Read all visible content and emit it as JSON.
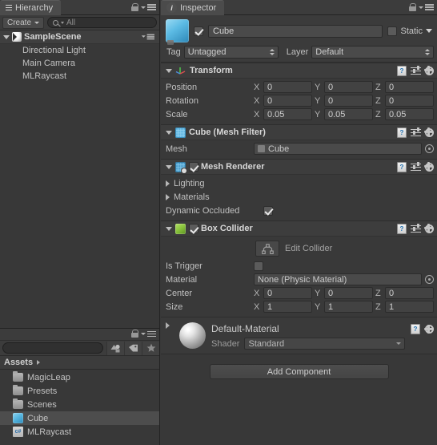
{
  "hierarchy": {
    "tab_label": "Hierarchy",
    "tab_icon": "hierarchy-icon",
    "create_label": "Create",
    "search_placeholder": "All",
    "search_value": "All",
    "scene": {
      "name": "SampleScene",
      "icon": "unity-scene-icon"
    },
    "items": [
      {
        "label": "Directional Light"
      },
      {
        "label": "Main Camera"
      },
      {
        "label": "MLRaycast"
      }
    ]
  },
  "project": {
    "search_value": "",
    "search_placeholder": "",
    "filters": [
      {
        "name": "type-filter-icon"
      },
      {
        "name": "label-filter-icon"
      },
      {
        "name": "favorites-star-icon"
      }
    ],
    "breadcrumb": "Assets",
    "items": [
      {
        "label": "MagicLeap",
        "icon": "folder-icon",
        "selected": false
      },
      {
        "label": "Presets",
        "icon": "folder-icon",
        "selected": false
      },
      {
        "label": "Scenes",
        "icon": "folder-icon",
        "selected": false
      },
      {
        "label": "Cube",
        "icon": "cube-prefab-icon",
        "selected": true
      },
      {
        "label": "MLRaycast",
        "icon": "csharp-script-icon",
        "selected": false
      }
    ]
  },
  "inspector": {
    "tab_label": "Inspector",
    "tab_icon": "info-icon",
    "gameobject": {
      "icon": "cube-prefab-icon",
      "enabled": true,
      "name": "Cube",
      "static_label": "Static",
      "static_checked": false,
      "tag_label": "Tag",
      "tag_value": "Untagged",
      "layer_label": "Layer",
      "layer_value": "Default"
    },
    "components": [
      {
        "title": "Transform",
        "icon": "transform-gizmo-icon",
        "has_enable_checkbox": false,
        "rows": [
          {
            "label": "Position",
            "type": "vector3",
            "x": "0",
            "y": "0",
            "z": "0"
          },
          {
            "label": "Rotation",
            "type": "vector3",
            "x": "0",
            "y": "0",
            "z": "0"
          },
          {
            "label": "Scale",
            "type": "vector3",
            "x": "0.05",
            "y": "0.05",
            "z": "0.05"
          }
        ]
      },
      {
        "title": "Cube (Mesh Filter)",
        "icon": "mesh-filter-icon",
        "has_enable_checkbox": false,
        "rows": [
          {
            "label": "Mesh",
            "type": "object",
            "value": "Cube"
          }
        ]
      },
      {
        "title": "Mesh Renderer",
        "icon": "mesh-renderer-icon",
        "has_enable_checkbox": true,
        "enabled": true,
        "rows": [
          {
            "label": "Lighting",
            "type": "foldout"
          },
          {
            "label": "Materials",
            "type": "foldout"
          },
          {
            "label": "Dynamic Occluded",
            "type": "checkbox",
            "checked": true
          }
        ]
      },
      {
        "title": "Box Collider",
        "icon": "box-collider-icon",
        "has_enable_checkbox": true,
        "enabled": true,
        "edit_collider_label": "Edit Collider",
        "rows": [
          {
            "label": "Is Trigger",
            "type": "checkbox",
            "checked": false
          },
          {
            "label": "Material",
            "type": "object",
            "value": "None (Physic Material)"
          },
          {
            "label": "Center",
            "type": "vector3",
            "x": "0",
            "y": "0",
            "z": "0"
          },
          {
            "label": "Size",
            "type": "vector3",
            "x": "1",
            "y": "1",
            "z": "1"
          }
        ]
      }
    ],
    "material": {
      "name": "Default-Material",
      "shader_label": "Shader",
      "shader_value": "Standard"
    },
    "add_component_label": "Add Component"
  },
  "axis_labels": {
    "x": "X",
    "y": "Y",
    "z": "Z"
  }
}
